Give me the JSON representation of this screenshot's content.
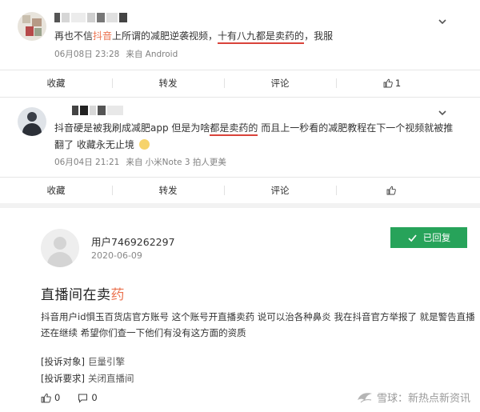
{
  "posts": [
    {
      "text_before": "再也不信",
      "text_highlight": "抖音",
      "text_middle": "上所谓的减肥逆袭视频，",
      "text_underlined": "十有八九都是卖药的",
      "text_after": "，我服",
      "date": "06月08日 23:28",
      "source": "来自 Android",
      "actions": {
        "collect": "收藏",
        "forward": "转发",
        "comment": "评论",
        "like_count": "1"
      }
    },
    {
      "line1_before": "抖音硬是被我刷成减肥app 但是为啥",
      "line1_underlined": "都是卖药的",
      "line1_after": " 而且上一秒看的减肥教程在下一个视频就被推",
      "line2": "翻了 收藏永无止境",
      "date": "06月04日 21:21",
      "source": "来自 小米Note 3 拍人更美",
      "actions": {
        "collect": "收藏",
        "forward": "转发",
        "comment": "评论"
      }
    }
  ],
  "complaint": {
    "user": "用户7469262297",
    "date": "2020-06-09",
    "status": "已回复",
    "title_plain": "直播间在卖",
    "title_highlight": "药",
    "body": "抖音用户id惧玉百货店官方账号 这个账号开直播卖药 说可以治各种鼻炎 我在抖音官方举报了 就是警告直播还在继续 希望你们查一下他们有没有这方面的资质",
    "target_label": "[投诉对象]",
    "target_value": "巨量引擎",
    "request_label": "[投诉要求]",
    "request_value": "关闭直播间",
    "like_count": "0",
    "comment_count": "0"
  },
  "watermark": "雪球：新热点新资讯",
  "colors": {
    "highlight": "#eb7350",
    "underline": "#d9433a",
    "replied_bg": "#27a35a"
  }
}
